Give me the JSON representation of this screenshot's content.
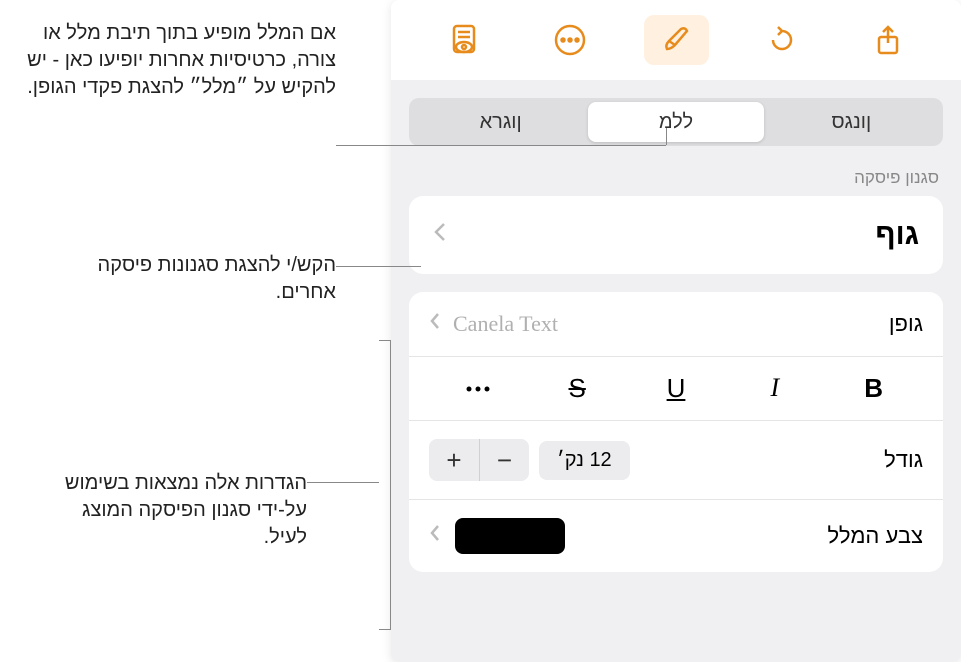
{
  "tabs": {
    "style": "ןונגס",
    "text": "ללמ",
    "arrange": "ןוגרא"
  },
  "paragraphStyle": {
    "sectionLabel": "סגנון פיסקה",
    "current": "גוף"
  },
  "font": {
    "label": "גופן",
    "name": "Canela Text",
    "bold": "B",
    "italic": "I",
    "underline": "U",
    "strikethrough": "S",
    "more": "•••"
  },
  "size": {
    "label": "גודל",
    "value": "12 נק׳",
    "minus": "−",
    "plus": "+"
  },
  "textColor": {
    "label": "צבע המלל"
  },
  "callouts": {
    "c1": "אם המלל מופיע בתוך תיבת מלל או צורה, כרטיסיות אחרות יופיעו כאן - יש להקיש על ״מלל״ להצגת פקדי הגופן.",
    "c2": "הקש/י להצגת סגנונות פיסקה אחרים.",
    "c3": "הגדרות אלה נמצאות בשימוש על-ידי סגנון הפיסקה המוצג לעיל."
  }
}
